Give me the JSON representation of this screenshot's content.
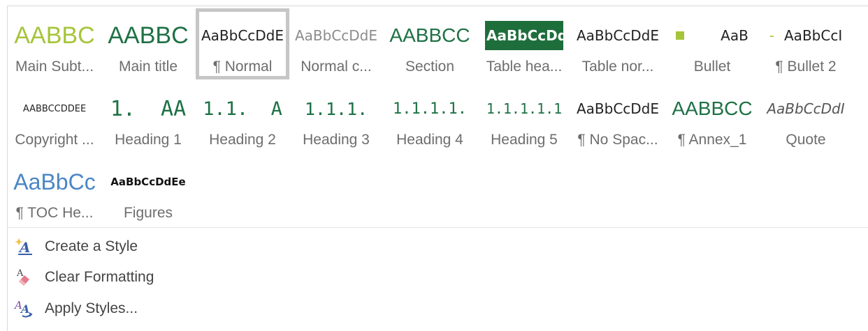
{
  "styles": {
    "row1": [
      {
        "preview": "AABBC",
        "name": "Main Subt...",
        "color": "#a6c43a"
      },
      {
        "preview": "AABBC",
        "name": "Main title",
        "color": "#1e7145"
      },
      {
        "preview": "AaBbCcDdE",
        "name": "¶ Normal",
        "color": "#222222",
        "selected": true
      },
      {
        "preview": "AaBbCcDdE",
        "name": "Normal c...",
        "color": "#8c8c8c"
      },
      {
        "preview": "AABBCC",
        "name": "Section",
        "color": "#1e7145"
      },
      {
        "preview": "AaBbCcDdI",
        "name": "Table hea...",
        "color": "#ffffff",
        "background": "#1e6e3c"
      },
      {
        "preview": "AaBbCcDdE",
        "name": "Table nor...",
        "color": "#222222"
      },
      {
        "preview": "AaB",
        "name": "Bullet",
        "color": "#222222"
      },
      {
        "preview": "AaBbCcI",
        "name": "¶ Bullet 2",
        "color": "#222222"
      }
    ],
    "row2": [
      {
        "preview": "AABBCCDDEE",
        "name": "Copyright ...",
        "color": "#222222"
      },
      {
        "preview": "1.  AA",
        "name": "Heading 1",
        "color": "#1e7145"
      },
      {
        "preview": "1.1.  A",
        "name": "Heading 2",
        "color": "#1e7145"
      },
      {
        "preview": "1.1.1.",
        "name": "Heading 3",
        "color": "#1e7145"
      },
      {
        "preview": "1.1.1.1.",
        "name": "Heading 4",
        "color": "#1e7145"
      },
      {
        "preview": "1.1.1.1.1",
        "name": "Heading 5",
        "color": "#1e7145"
      },
      {
        "preview": "AaBbCcDdE",
        "name": "¶ No Spac...",
        "color": "#222222"
      },
      {
        "preview": "AABBCC",
        "name": "¶ Annex_1",
        "color": "#1e7145"
      },
      {
        "preview": "AaBbCcDdI",
        "name": "Quote",
        "color": "#555555"
      }
    ],
    "row3": [
      {
        "preview": "AaBbCc",
        "name": "¶ TOC He...",
        "color": "#4a86c5"
      },
      {
        "preview": "AaBbCcDdEe",
        "name": "Figures",
        "color": "#111111"
      }
    ]
  },
  "menu": {
    "create_style": "Create a Style",
    "clear_formatting": "Clear Formatting",
    "apply_styles": "Apply Styles..."
  },
  "icons": {
    "create_style": "create-style-icon",
    "clear_formatting": "clear-formatting-icon",
    "apply_styles": "apply-styles-icon"
  },
  "colors": {
    "accent_green": "#1e7145",
    "light_green": "#a6c43a",
    "selected_border": "#c6c6c6"
  }
}
